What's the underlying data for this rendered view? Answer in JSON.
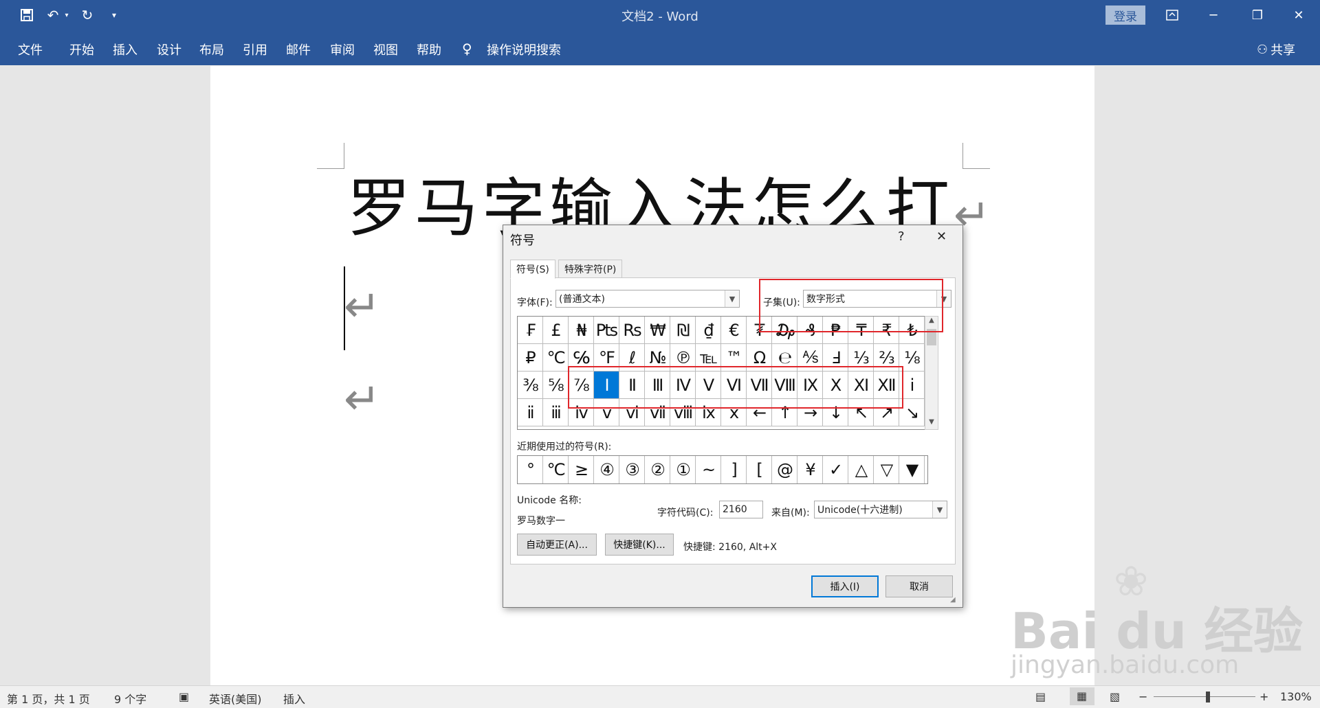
{
  "window": {
    "title": "文档2  -  Word",
    "login": "登录",
    "quick_access": [
      "save-icon",
      "undo-icon",
      "redo-icon",
      "customize-icon"
    ]
  },
  "ribbon": {
    "tabs": [
      "文件",
      "开始",
      "插入",
      "设计",
      "布局",
      "引用",
      "邮件",
      "审阅",
      "视图",
      "帮助"
    ],
    "tell_me": "操作说明搜索",
    "share": "共享"
  },
  "document": {
    "heading": "罗马字输入法怎么打",
    "para_mark": "↵"
  },
  "dialog": {
    "title": "符号",
    "help": "?",
    "close": "✕",
    "tabs": [
      "符号(S)",
      "特殊字符(P)"
    ],
    "font_label": "字体(F):",
    "font_value": "(普通文本)",
    "subset_label": "子集(U):",
    "subset_value": "数字形式",
    "symbols": [
      "₣",
      "£",
      "₦",
      "Pts",
      "Rs",
      "₩",
      "₪",
      "₫",
      "€",
      "₮",
      "₯",
      "₰",
      "₱",
      "₸",
      "₹",
      "₺",
      "₽",
      "°C",
      "℅",
      "°F",
      "ℓ",
      "№",
      "℗",
      "℡",
      "™",
      "Ω",
      "℮",
      "⅍",
      "Ⅎ",
      "⅓",
      "⅔",
      "⅛",
      "⅜",
      "⅝",
      "⅞",
      "Ⅰ",
      "Ⅱ",
      "Ⅲ",
      "Ⅳ",
      "Ⅴ",
      "Ⅵ",
      "Ⅶ",
      "Ⅷ",
      "Ⅸ",
      "Ⅹ",
      "Ⅺ",
      "Ⅻ",
      "ⅰ",
      "ⅱ",
      "ⅲ",
      "ⅳ",
      "ⅴ",
      "ⅵ",
      "ⅶ",
      "ⅷ",
      "ⅸ",
      "ⅹ",
      "←",
      "↑",
      "→",
      "↓",
      "↖",
      "↗",
      "↘"
    ],
    "selected_index": 35,
    "recent_label": "近期使用过的符号(R):",
    "recent": [
      "°",
      "°C",
      "≥",
      "④",
      "③",
      "②",
      "①",
      "~",
      "]",
      "[",
      "@",
      "¥",
      "✓",
      "△",
      "▽",
      "▼"
    ],
    "unicode_name_label": "Unicode 名称:",
    "unicode_name": "罗马数字一",
    "char_code_label": "字符代码(C):",
    "char_code": "2160",
    "from_label": "来自(M):",
    "from_value": "Unicode(十六进制)",
    "autocorrect": "自动更正(A)...",
    "shortcut_key_btn": "快捷键(K)...",
    "shortcut_text": "快捷键: 2160, Alt+X",
    "insert": "插入(I)",
    "cancel": "取消"
  },
  "status": {
    "page": "第 1 页，共 1 页",
    "words": "9 个字",
    "language": "英语(美国)",
    "mode": "插入",
    "zoom": "130%"
  },
  "watermark": {
    "line1": "Bai du 经验",
    "line2": "jingyan.baidu.com"
  }
}
